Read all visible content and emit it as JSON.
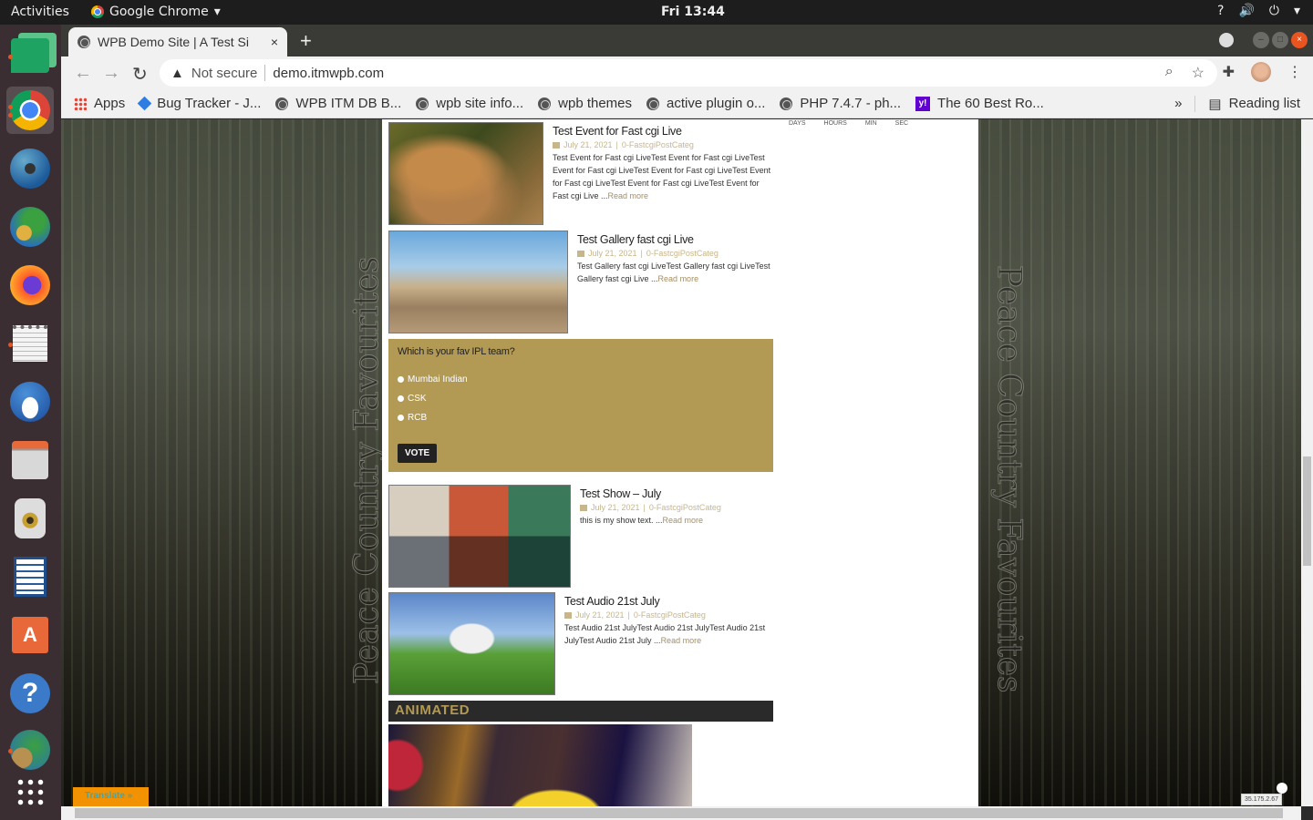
{
  "topbar": {
    "activities": "Activities",
    "app_name": "Google Chrome",
    "clock": "Fri 13:44",
    "tray": [
      "?",
      "🔊",
      "⏻",
      "▾"
    ]
  },
  "dock": {
    "items": [
      "google-chat",
      "chrome",
      "network-globe",
      "network-plug",
      "firefox",
      "text-editor",
      "thunderbird",
      "file-cabinet",
      "speaker",
      "libreoffice-writer",
      "software-store",
      "help",
      "world-map",
      "show-apps"
    ]
  },
  "browser": {
    "tab_title": "WPB Demo Site | A Test Si",
    "tab_close": "×",
    "new_tab": "+",
    "not_secure": "Not secure",
    "url": "demo.itmwpb.com",
    "bookmarks": [
      {
        "label": "Apps",
        "icon": "apps-grid"
      },
      {
        "label": "Bug Tracker - J...",
        "icon": "jira-diamond"
      },
      {
        "label": "WPB ITM DB B...",
        "icon": "globe"
      },
      {
        "label": "wpb site info...",
        "icon": "globe"
      },
      {
        "label": "wpb themes",
        "icon": "globe"
      },
      {
        "label": "active plugin o...",
        "icon": "globe"
      },
      {
        "label": "PHP 7.4.7 - ph...",
        "icon": "globe"
      },
      {
        "label": "The 60 Best Ro...",
        "icon": "yahoo"
      }
    ],
    "more_bookmarks": "»",
    "reading_list": "Reading list"
  },
  "page": {
    "side_text": "Peace Country Favourites",
    "countdown_labels": [
      "DAYS",
      "HOURS",
      "MIN",
      "SEC"
    ],
    "posts": [
      {
        "title": "Test Event for Fast cgi Live",
        "date": "July 21, 2021",
        "category": "0-FastcgiPostCateg",
        "excerpt": "Test Event for Fast cgi LiveTest Event for Fast cgi LiveTest Event for Fast cgi LiveTest Event for Fast cgi LiveTest Event for Fast cgi LiveTest Event for Fast cgi LiveTest Event for Fast cgi Live ...",
        "read_more": "Read more"
      },
      {
        "title": "Test Gallery fast cgi Live",
        "date": "July 21, 2021",
        "category": "0-FastcgiPostCateg",
        "excerpt": "Test Gallery fast cgi LiveTest Gallery fast cgi LiveTest Gallery fast cgi Live ...",
        "read_more": "Read more"
      },
      {
        "title": "Test Show – July",
        "date": "July 21, 2021",
        "category": "0-FastcgiPostCateg",
        "excerpt": "this is my show text. ...",
        "read_more": "Read more"
      },
      {
        "title": "Test Audio 21st July",
        "date": "July 21, 2021",
        "category": "0-FastcgiPostCateg",
        "excerpt": "Test Audio 21st JulyTest Audio 21st JulyTest Audio 21st JulyTest Audio 21st July ...",
        "read_more": "Read more"
      }
    ],
    "poll": {
      "question": "Which is your fav IPL team?",
      "options": [
        "Mumbai Indian",
        "CSK",
        "RCB"
      ],
      "vote_label": "VOTE"
    },
    "animated_heading": "ANIMATED",
    "translate_label": "Translate »",
    "ip_badge": "35.175.2.67"
  }
}
